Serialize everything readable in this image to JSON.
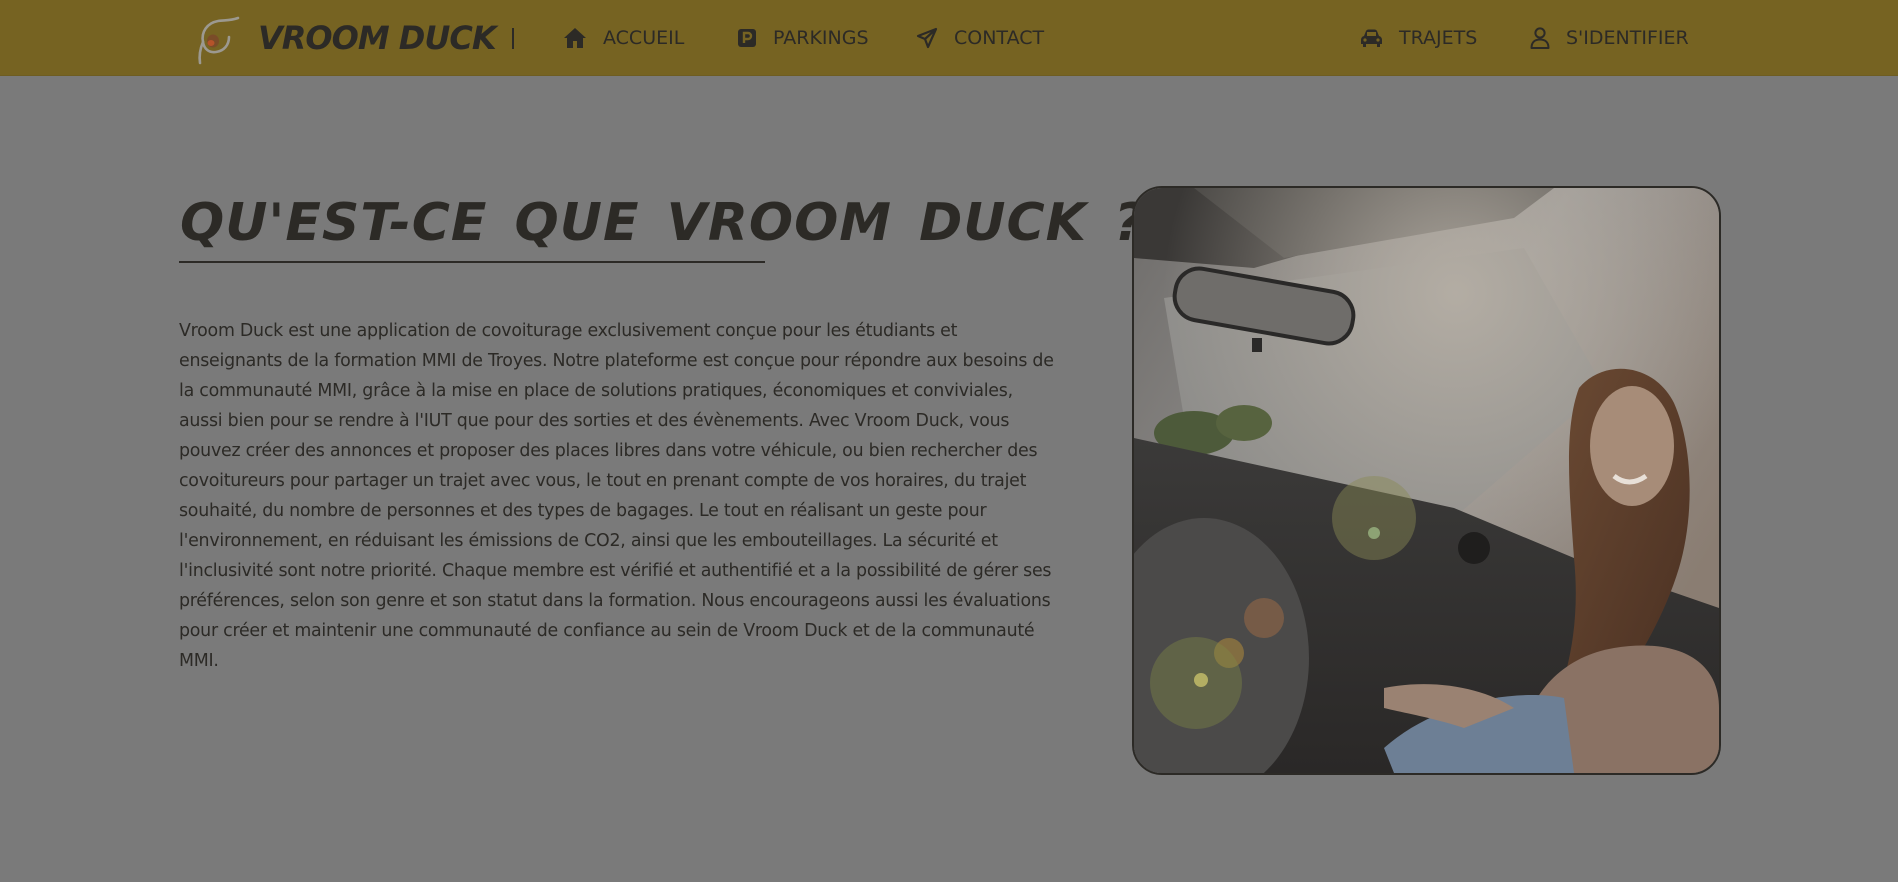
{
  "header": {
    "brand": "VROOM DUCK",
    "nav_left": [
      {
        "label": "ACCUEIL",
        "icon": "home-icon"
      },
      {
        "label": "PARKINGS",
        "icon": "parking-icon"
      },
      {
        "label": "CONTACT",
        "icon": "paper-plane-icon"
      }
    ],
    "nav_right": [
      {
        "label": "TRAJETS",
        "icon": "car-icon"
      },
      {
        "label": "S'IDENTIFIER",
        "icon": "user-icon"
      }
    ]
  },
  "main": {
    "title": "QU'EST-CE QUE VROOM DUCK ?",
    "description": "Vroom Duck est une application de covoiturage exclusivement conçue pour les étudiants et enseignants de la formation MMI de Troyes. Notre plateforme est conçue pour répondre aux besoins de la communauté MMI, grâce à la mise en place de solutions pratiques, économiques et conviviales, aussi bien pour se rendre à l'IUT que pour des sorties et des évènements. Avec Vroom Duck, vous pouvez créer des annonces et proposer des places libres dans votre véhicule, ou bien rechercher des covoitureurs pour partager un trajet avec vous, le tout en prenant compte de vos horaires, du trajet souhaité, du nombre de personnes et des types de bagages. Le tout en réalisant un geste pour l'environnement, en réduisant les émissions de CO2, ainsi que les embouteillages. La sécurité et l'inclusivité sont notre priorité. Chaque membre est vérifié et authentifié et a la possibilité de gérer ses préférences, selon son genre et son statut dans la formation. Nous encourageons aussi les évaluations pour créer et maintenir une communauté de confiance au sein de Vroom Duck et de la communauté MMI."
  },
  "colors": {
    "header_bg": "#766322",
    "page_bg": "#7a7a7a",
    "text": "#2c2a26"
  }
}
